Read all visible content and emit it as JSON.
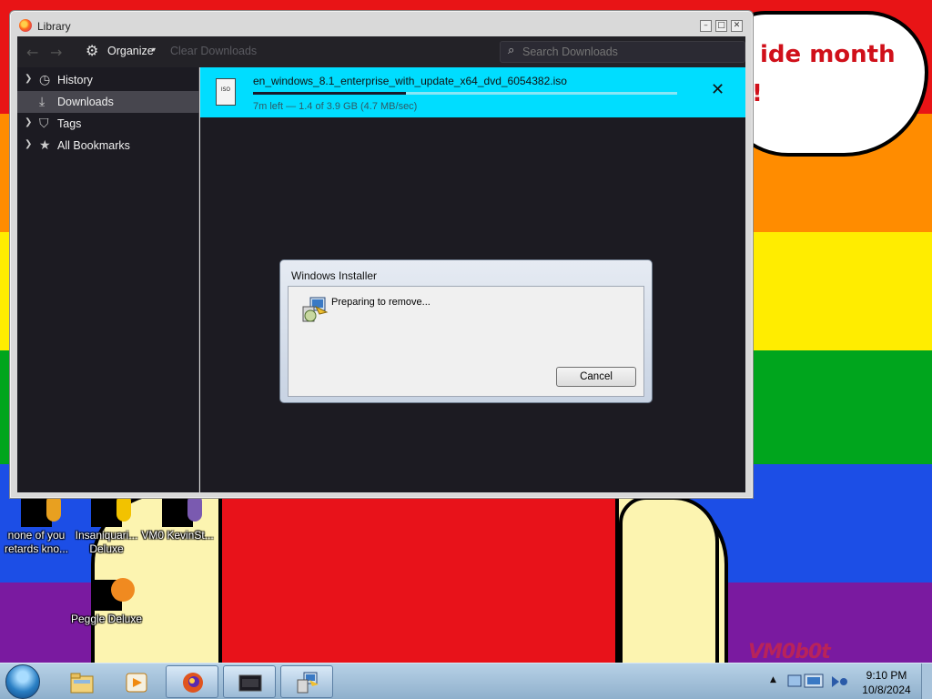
{
  "desktop": {
    "bubble_text_line1": "ide month",
    "bubble_text_line2": "!",
    "watermark": "VM0b0t",
    "icons": [
      {
        "label": "none of you retards kno...",
        "icon": "firefox-profile-icon"
      },
      {
        "label": "Insaniquari... Deluxe",
        "icon": "game-icon"
      },
      {
        "label": "VM0 KevinSt...",
        "icon": "shortcut-icon"
      },
      {
        "label": "Peggle Deluxe",
        "icon": "peggle-icon"
      }
    ]
  },
  "library": {
    "title": "Library",
    "toolbar": {
      "organize_label": "Organize",
      "clear_label": "Clear Downloads",
      "search_placeholder": "Search Downloads"
    },
    "sidebar": {
      "items": [
        {
          "label": "History",
          "icon": "clock-icon",
          "selected": false
        },
        {
          "label": "Downloads",
          "icon": "download-icon",
          "selected": true
        },
        {
          "label": "Tags",
          "icon": "tag-icon",
          "selected": false
        },
        {
          "label": "All Bookmarks",
          "icon": "star-icon",
          "selected": false
        }
      ]
    },
    "download": {
      "file_name": "en_windows_8.1_enterprise_with_update_x64_dvd_6054382.iso",
      "file_icon_text": "ISO",
      "status": "7m left — 1.4 of 3.9 GB (4.7 MB/sec)",
      "progress": 0.36
    }
  },
  "installer": {
    "title": "Windows Installer",
    "message": "Preparing to remove...",
    "cancel_label": "Cancel"
  },
  "taskbar": {
    "clock_time": "9:10 PM",
    "clock_date": "10/8/2024",
    "buttons": [
      {
        "name": "explorer",
        "open": false
      },
      {
        "name": "media-player",
        "open": false
      },
      {
        "name": "firefox",
        "open": true
      },
      {
        "name": "library-window",
        "open": true
      },
      {
        "name": "windows-installer",
        "open": true
      }
    ]
  },
  "colors": {
    "download_highlight": "#00ddff",
    "dark_bg": "#1c1b22",
    "toolbar_bg": "#232227"
  }
}
